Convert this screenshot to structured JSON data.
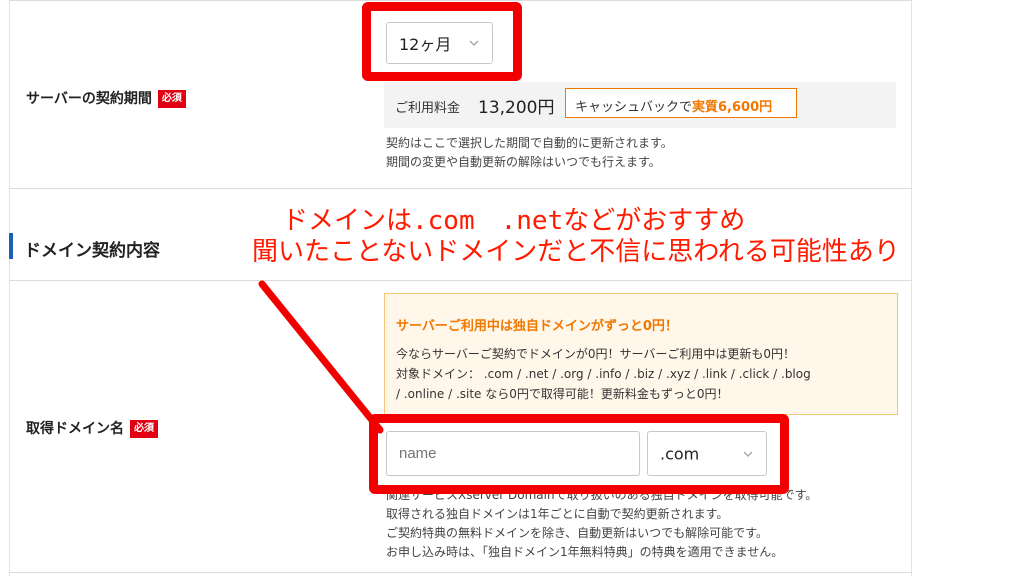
{
  "contract_period": {
    "label": "サーバーの契約期間",
    "required_badge": "必須",
    "selected": "12ヶ月",
    "price_label": "ご利用料金",
    "price": "13,200円",
    "cashback_prefix": "キャッシュバックで",
    "cashback_value": "実質6,600円",
    "notes": [
      "契約はここで選択した期間で自動的に更新されます。",
      "期間の変更や自動更新の解除はいつでも行えます。"
    ]
  },
  "domain_section": {
    "title": "ドメイン契約内容"
  },
  "annotation": {
    "line1": "ドメインは.com　.netなどがおすすめ",
    "line2": "聞いたことないドメインだと不信に思われる可能性あり"
  },
  "promo": {
    "title": "サーバーご利用中は独自ドメインがずっと0円！",
    "lines": [
      "今ならサーバーご契約でドメインが0円！サーバーご利用中は更新も0円！",
      "対象ドメイン： .com / .net / .org / .info / .biz / .xyz / .link / .click / .blog",
      "/ .online / .site なら0円で取得可能！更新料金もずっと0円！"
    ]
  },
  "domain_name": {
    "label": "取得ドメイン名",
    "required_badge": "必須",
    "placeholder": "name",
    "tld_selected": ".com",
    "notes": [
      "関連サービスXserver Domainで取り扱いのある独自ドメインを取得可能です。",
      "取得される独自ドメインは1年ごとに自動で契約更新されます。",
      "ご契約特典の無料ドメインを除き、自動更新はいつでも解除可能です。",
      "お申し込み時は、「独自ドメイン1年無料特典」の特典を適用できません。"
    ]
  },
  "colors": {
    "accent_red": "#f20000",
    "required_red": "#e00012",
    "orange": "#f07800",
    "section_blue": "#1a5fb4"
  }
}
